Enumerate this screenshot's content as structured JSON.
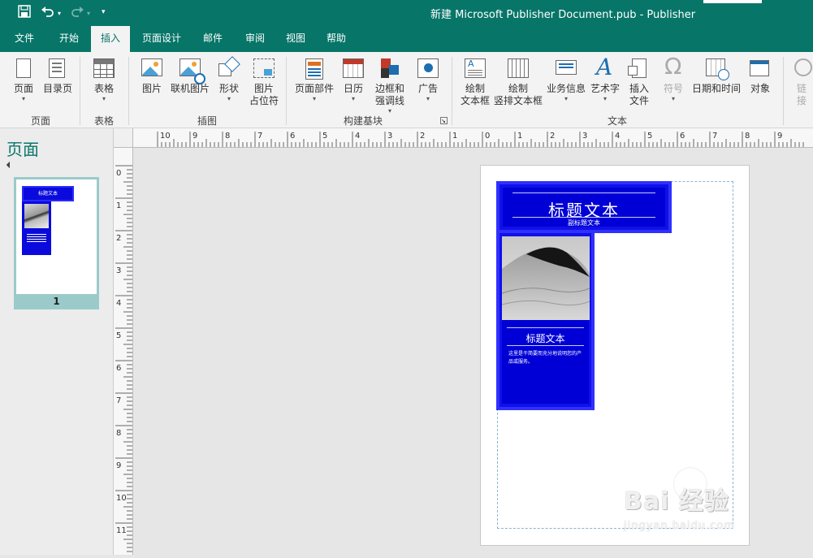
{
  "titlebar": {
    "title": "新建 Microsoft Publisher Document.pub  -  Publisher",
    "save_icon": "save-icon",
    "undo_icon": "undo-icon",
    "redo_icon": "redo-icon",
    "customize_icon": "customize-quick-access-icon",
    "bg_color": "#077568"
  },
  "tabs": [
    {
      "label": "文件"
    },
    {
      "label": "开始"
    },
    {
      "label": "插入",
      "active": true
    },
    {
      "label": "页面设计"
    },
    {
      "label": "邮件"
    },
    {
      "label": "审阅"
    },
    {
      "label": "视图"
    },
    {
      "label": "帮助"
    }
  ],
  "ribbon": {
    "groups": {
      "pages": "页面",
      "tables": "表格",
      "illustrations": "插图",
      "building_blocks": "构建基块",
      "text": "文本"
    },
    "buttons": {
      "page": "页面",
      "catalog_page": "目录页",
      "table": "表格",
      "picture": "图片",
      "online_pictures": "联机图片",
      "shapes": "形状",
      "picture_placeholder_1": "图片",
      "picture_placeholder_2": "占位符",
      "page_parts": "页面部件",
      "calendars": "日历",
      "borders_1": "边框和",
      "borders_2": "强调线",
      "advertisements": "广告",
      "draw_textbox_1": "绘制",
      "draw_textbox_2": "文本框",
      "draw_vtextbox_1": "绘制",
      "draw_vtextbox_2": "竖排文本框",
      "business_info": "业务信息",
      "wordart": "艺术字",
      "insert_file_1": "插入",
      "insert_file_2": "文件",
      "symbol": "符号",
      "date_time": "日期和时间",
      "object": "对象",
      "link_1": "链",
      "link_2": "接"
    },
    "caret": "▾",
    "launcher": "↘"
  },
  "pane": {
    "title": "页面",
    "thumbnail_number": "1",
    "thumb_header": "标题文本"
  },
  "rulers": {
    "h_labels": [
      "10",
      "9",
      "8",
      "7",
      "6",
      "5",
      "4",
      "3",
      "2",
      "1",
      "0",
      "1",
      "2",
      "3",
      "4",
      "5",
      "6",
      "7",
      "8",
      "9"
    ],
    "v_labels": [
      "0",
      "1",
      "2",
      "3",
      "4",
      "5",
      "6",
      "7",
      "8",
      "9",
      "10",
      "11"
    ]
  },
  "document": {
    "header_title": "标题文本",
    "header_subtitle": "副标题文本",
    "column_title": "标题文本",
    "column_body": "这里是干简要而充分地说明您的产品或服务。",
    "accent_color": "#0000d6"
  },
  "watermark": {
    "line1": "Bai 经验",
    "line2": "jingyan.baidu.com"
  }
}
